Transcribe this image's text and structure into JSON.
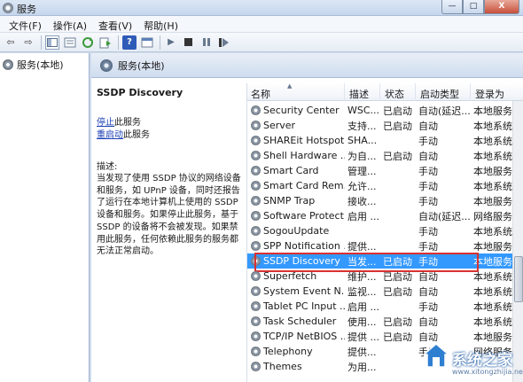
{
  "window": {
    "title": "服务",
    "min": "—",
    "max": "□",
    "close": "X"
  },
  "menu": [
    {
      "label": "文件(F)"
    },
    {
      "label": "操作(A)"
    },
    {
      "label": "查看(V)"
    },
    {
      "label": "帮助(H)"
    }
  ],
  "toolbar": {
    "back": "⇦",
    "forward": "⇨",
    "help": "?"
  },
  "tree": {
    "root_label": "服务(本地)"
  },
  "content": {
    "header_title": "服务(本地)",
    "selected_name": "SSDP Discovery",
    "stop_link": "停止",
    "stop_suffix": "此服务",
    "restart_link": "重启动",
    "restart_suffix": "此服务",
    "desc_label": "描述:",
    "desc_text": "当发现了使用 SSDP 协议的网络设备和服务，如 UPnP 设备，同时还报告了运行在本地计算机上使用的 SSDP 设备和服务。如果停止此服务，基于 SSDP 的设备将不会被发现。如果禁用此服务，任何依赖此服务的服务都无法正常启动。"
  },
  "table": {
    "columns": [
      "名称",
      "描述",
      "状态",
      "启动类型",
      "登录为"
    ],
    "rows": [
      {
        "name": "Security Center",
        "desc": "WSC...",
        "status": "已启动",
        "start": "自动(延迟...",
        "logon": "本地服务"
      },
      {
        "name": "Server",
        "desc": "支持...",
        "status": "已启动",
        "start": "自动",
        "logon": "本地系统"
      },
      {
        "name": "SHAREit Hotspot...",
        "desc": "SHA...",
        "status": "",
        "start": "手动",
        "logon": "本地系统"
      },
      {
        "name": "Shell Hardware ...",
        "desc": "为自...",
        "status": "已启动",
        "start": "自动",
        "logon": "本地系统"
      },
      {
        "name": "Smart Card",
        "desc": "管理...",
        "status": "",
        "start": "手动",
        "logon": "本地服务"
      },
      {
        "name": "Smart Card Rem...",
        "desc": "允许...",
        "status": "",
        "start": "手动",
        "logon": "本地系统"
      },
      {
        "name": "SNMP Trap",
        "desc": "接收...",
        "status": "",
        "start": "手动",
        "logon": "本地服务"
      },
      {
        "name": "Software Protect...",
        "desc": "启用 ...",
        "status": "",
        "start": "自动(延迟...",
        "logon": "网络服务"
      },
      {
        "name": "SogouUpdate",
        "desc": "",
        "status": "",
        "start": "手动",
        "logon": "本地系统"
      },
      {
        "name": "SPP Notification ...",
        "desc": "提供...",
        "status": "",
        "start": "手动",
        "logon": "本地服务"
      },
      {
        "name": "SSDP Discovery",
        "desc": "当发...",
        "status": "已启动",
        "start": "手动",
        "logon": "本地服务",
        "selected": true
      },
      {
        "name": "Superfetch",
        "desc": "维护...",
        "status": "已启动",
        "start": "自动",
        "logon": "本地系统"
      },
      {
        "name": "System Event N...",
        "desc": "监视...",
        "status": "已启动",
        "start": "自动",
        "logon": "本地系统"
      },
      {
        "name": "Tablet PC Input ...",
        "desc": "启用 ...",
        "status": "",
        "start": "手动",
        "logon": "本地系统"
      },
      {
        "name": "Task Scheduler",
        "desc": "使用...",
        "status": "已启动",
        "start": "自动",
        "logon": "本地系统"
      },
      {
        "name": "TCP/IP NetBIOS ...",
        "desc": "提供 ...",
        "status": "已启动",
        "start": "自动",
        "logon": "本地服务"
      },
      {
        "name": "Telephony",
        "desc": "提供...",
        "status": "",
        "start": "手动",
        "logon": "网络服务"
      },
      {
        "name": "Themes",
        "desc": "为用...",
        "status": "",
        "start": "",
        "logon": ""
      }
    ]
  },
  "watermark": {
    "text": "系统之家",
    "url": "www.xitongzhijia.net"
  }
}
